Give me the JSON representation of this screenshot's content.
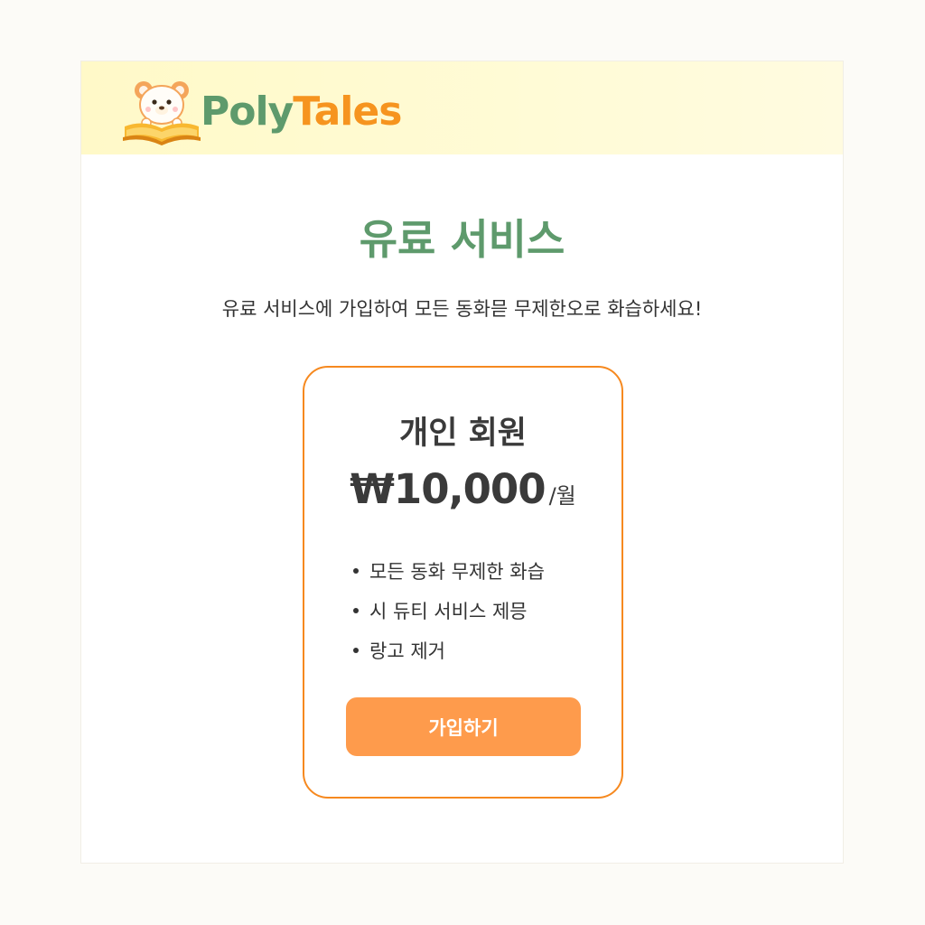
{
  "header": {
    "logo_icon": "bear-reading-book-icon",
    "brand_part1": "Poly",
    "brand_part2": "Tales"
  },
  "main": {
    "title": "유료 서비스",
    "subtitle": "유료 서비스에 가입하여 모든 동화믇 무제한오로 화습하세요!"
  },
  "plan": {
    "name": "개인 회원",
    "price": "₩10,000",
    "unit": "/월",
    "features": [
      "모든 동화 무제한 화습",
      "시 듀티 서비스 제믕",
      "랑고 제거"
    ],
    "button_label": "가입하기"
  },
  "colors": {
    "brand_green": "#5e9a6c",
    "brand_orange": "#f6941f",
    "card_border": "#f6891f",
    "button_bg": "#fe9b4c",
    "header_bg": "#fff9c8"
  }
}
